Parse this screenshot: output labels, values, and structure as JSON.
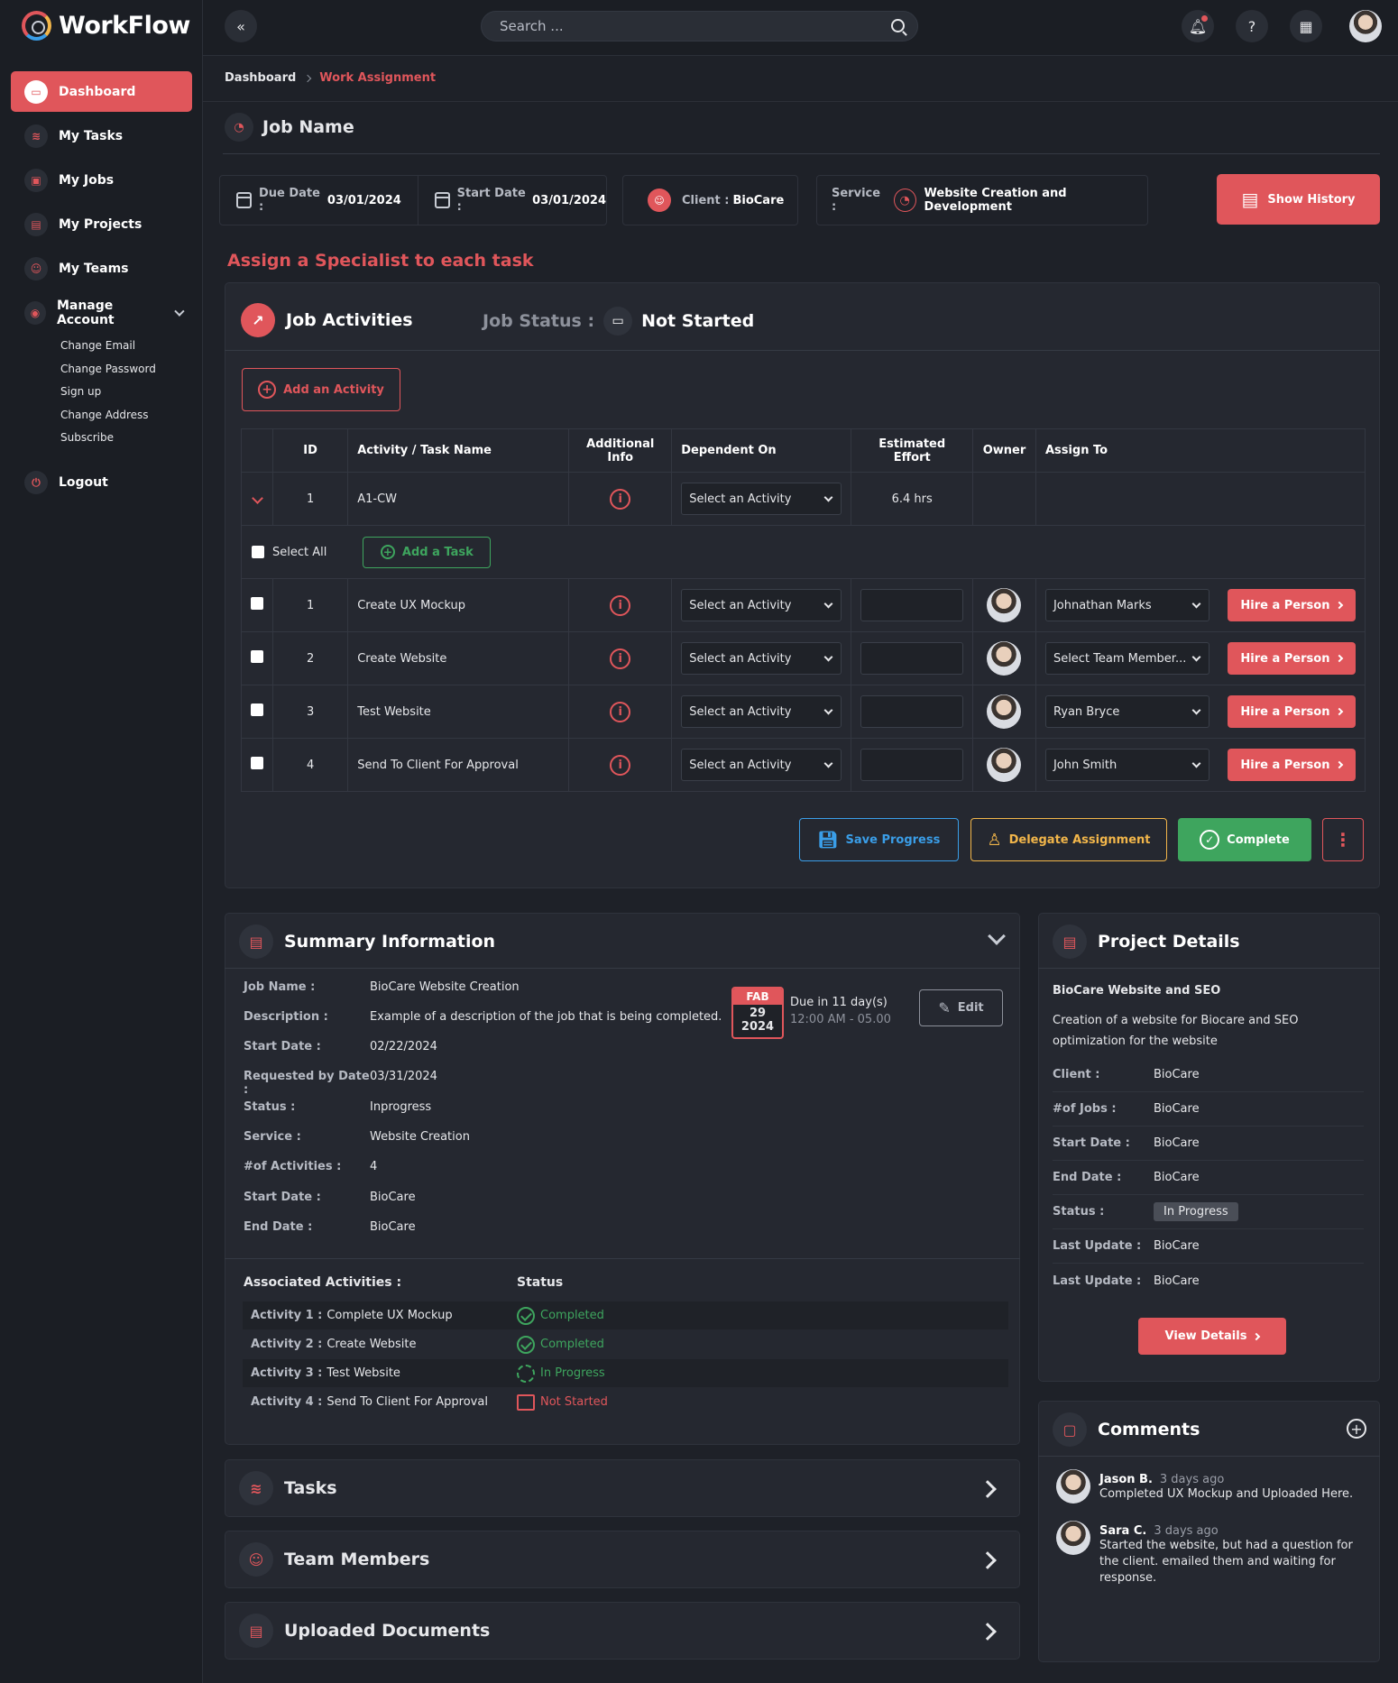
{
  "app": {
    "name": "WorkFlow"
  },
  "sidebar": {
    "items": [
      {
        "label": "Dashboard",
        "icon": "monitor-icon",
        "active": true
      },
      {
        "label": "My Tasks",
        "icon": "layers-icon"
      },
      {
        "label": "My Jobs",
        "icon": "briefcase-icon"
      },
      {
        "label": "My Projects",
        "icon": "document-icon"
      },
      {
        "label": "My Teams",
        "icon": "users-icon"
      },
      {
        "label": "Manage Account",
        "icon": "user-circle-icon"
      }
    ],
    "sub_items": [
      "Change Email",
      "Change Password",
      "Sign up",
      "Change Address",
      "Subscribe"
    ],
    "logout": "Logout"
  },
  "topbar": {
    "search_placeholder": "Search ..."
  },
  "breadcrumb": {
    "root": "Dashboard",
    "current": "Work Assignment"
  },
  "page": {
    "title": "Job Name"
  },
  "info": {
    "due_label": "Due Date :",
    "due_value": "03/01/2024",
    "start_label": "Start Date :",
    "start_value": "03/01/2024",
    "client_label": "Client :",
    "client_value": "BioCare",
    "service_label": "Service :",
    "service_value": "Website Creation and Development",
    "history_button": "Show History"
  },
  "assign_heading": "Assign a Specialist to each task",
  "activities": {
    "title": "Job Activities",
    "status_label": "Job Status :",
    "status_value": "Not Started",
    "add_activity": "Add an Activity",
    "columns": [
      "ID",
      "Activity / Task Name",
      "Additional Info",
      "Dependent On",
      "Estimated Effort",
      "Owner",
      "Assign To"
    ],
    "activity": {
      "id": "1",
      "name": "A1-CW",
      "dependent": "Select an Activity",
      "effort": "6.4 hrs"
    },
    "select_all": "Select All",
    "add_task": "Add a Task",
    "tasks": [
      {
        "id": "1",
        "name": "Create UX Mockup",
        "dependent": "Select an Activity",
        "assign": "Johnathan Marks",
        "hire": "Hire a Person"
      },
      {
        "id": "2",
        "name": "Create Website",
        "dependent": "Select an Activity",
        "assign": "Select Team Member...",
        "hire": "Hire a Person"
      },
      {
        "id": "3",
        "name": "Test Website",
        "dependent": "Select an Activity",
        "assign": "Ryan Bryce",
        "hire": "Hire a Person"
      },
      {
        "id": "4",
        "name": "Send To Client For Approval",
        "dependent": "Select an Activity",
        "assign": "John Smith",
        "hire": "Hire a Person"
      }
    ],
    "save": "Save Progress",
    "delegate": "Delegate Assignment",
    "complete": "Complete"
  },
  "summary": {
    "title": "Summary Information",
    "rows": [
      {
        "k": "Job Name :",
        "v": "BioCare Website Creation"
      },
      {
        "k": "Description :",
        "v": "Example of a description of the job that is being completed."
      },
      {
        "k": "Start Date :",
        "v": "02/22/2024"
      },
      {
        "k": "Requested by Date :",
        "v": "03/31/2024"
      },
      {
        "k": "Status :",
        "v": "Inprogress"
      },
      {
        "k": "Service :",
        "v": "Website Creation"
      },
      {
        "k": "#of Activities :",
        "v": "4"
      },
      {
        "k": "Start Date :",
        "v": "BioCare"
      },
      {
        "k": "End Date :",
        "v": "BioCare"
      }
    ],
    "calendar": {
      "month": "FAB",
      "day": "29",
      "year": "2024"
    },
    "due_text": "Due in 11 day(s)",
    "due_time": "12:00 AM - 05.00",
    "edit": "Edit",
    "assoc_label": "Associated Activities :",
    "status_label": "Status",
    "activities": [
      {
        "k": "Activity 1 :",
        "name": "Complete UX Mockup",
        "status": "Completed"
      },
      {
        "k": "Activity 2 :",
        "name": "Create Website",
        "status": "Completed"
      },
      {
        "k": "Activity 3 :",
        "name": "Test Website",
        "status": "In Progress"
      },
      {
        "k": "Activity 4 :",
        "name": "Send To Client For Approval",
        "status": "Not Started"
      }
    ]
  },
  "sections": {
    "tasks": "Tasks",
    "team": "Team Members",
    "docs": "Uploaded Documents"
  },
  "project": {
    "title": "Project Details",
    "name": "BioCare Website and SEO",
    "description": "Creation of a website for Biocare and SEO optimization for the website",
    "rows": [
      {
        "k": "Client :",
        "v": "BioCare"
      },
      {
        "k": "#of Jobs :",
        "v": "BioCare"
      },
      {
        "k": "Start Date :",
        "v": "BioCare"
      },
      {
        "k": "End Date :",
        "v": "BioCare"
      },
      {
        "k": "Status :",
        "v": "In Progress"
      },
      {
        "k": "Last Update :",
        "v": "BioCare"
      },
      {
        "k": "Last Update :",
        "v": "BioCare"
      }
    ],
    "view_details": "View Details"
  },
  "comments": {
    "title": "Comments",
    "items": [
      {
        "name": "Jason B.",
        "time": "3 days ago",
        "text": "Completed UX Mockup and Uploaded Here."
      },
      {
        "name": "Sara C.",
        "time": "3 days ago",
        "text": "Started the website, but had a question for the client. emailed them and waiting for response."
      }
    ]
  },
  "colors": {
    "accent": "#e0565b",
    "success": "#3ea55e",
    "warning": "#f2b64a",
    "info": "#3a9ee8"
  }
}
